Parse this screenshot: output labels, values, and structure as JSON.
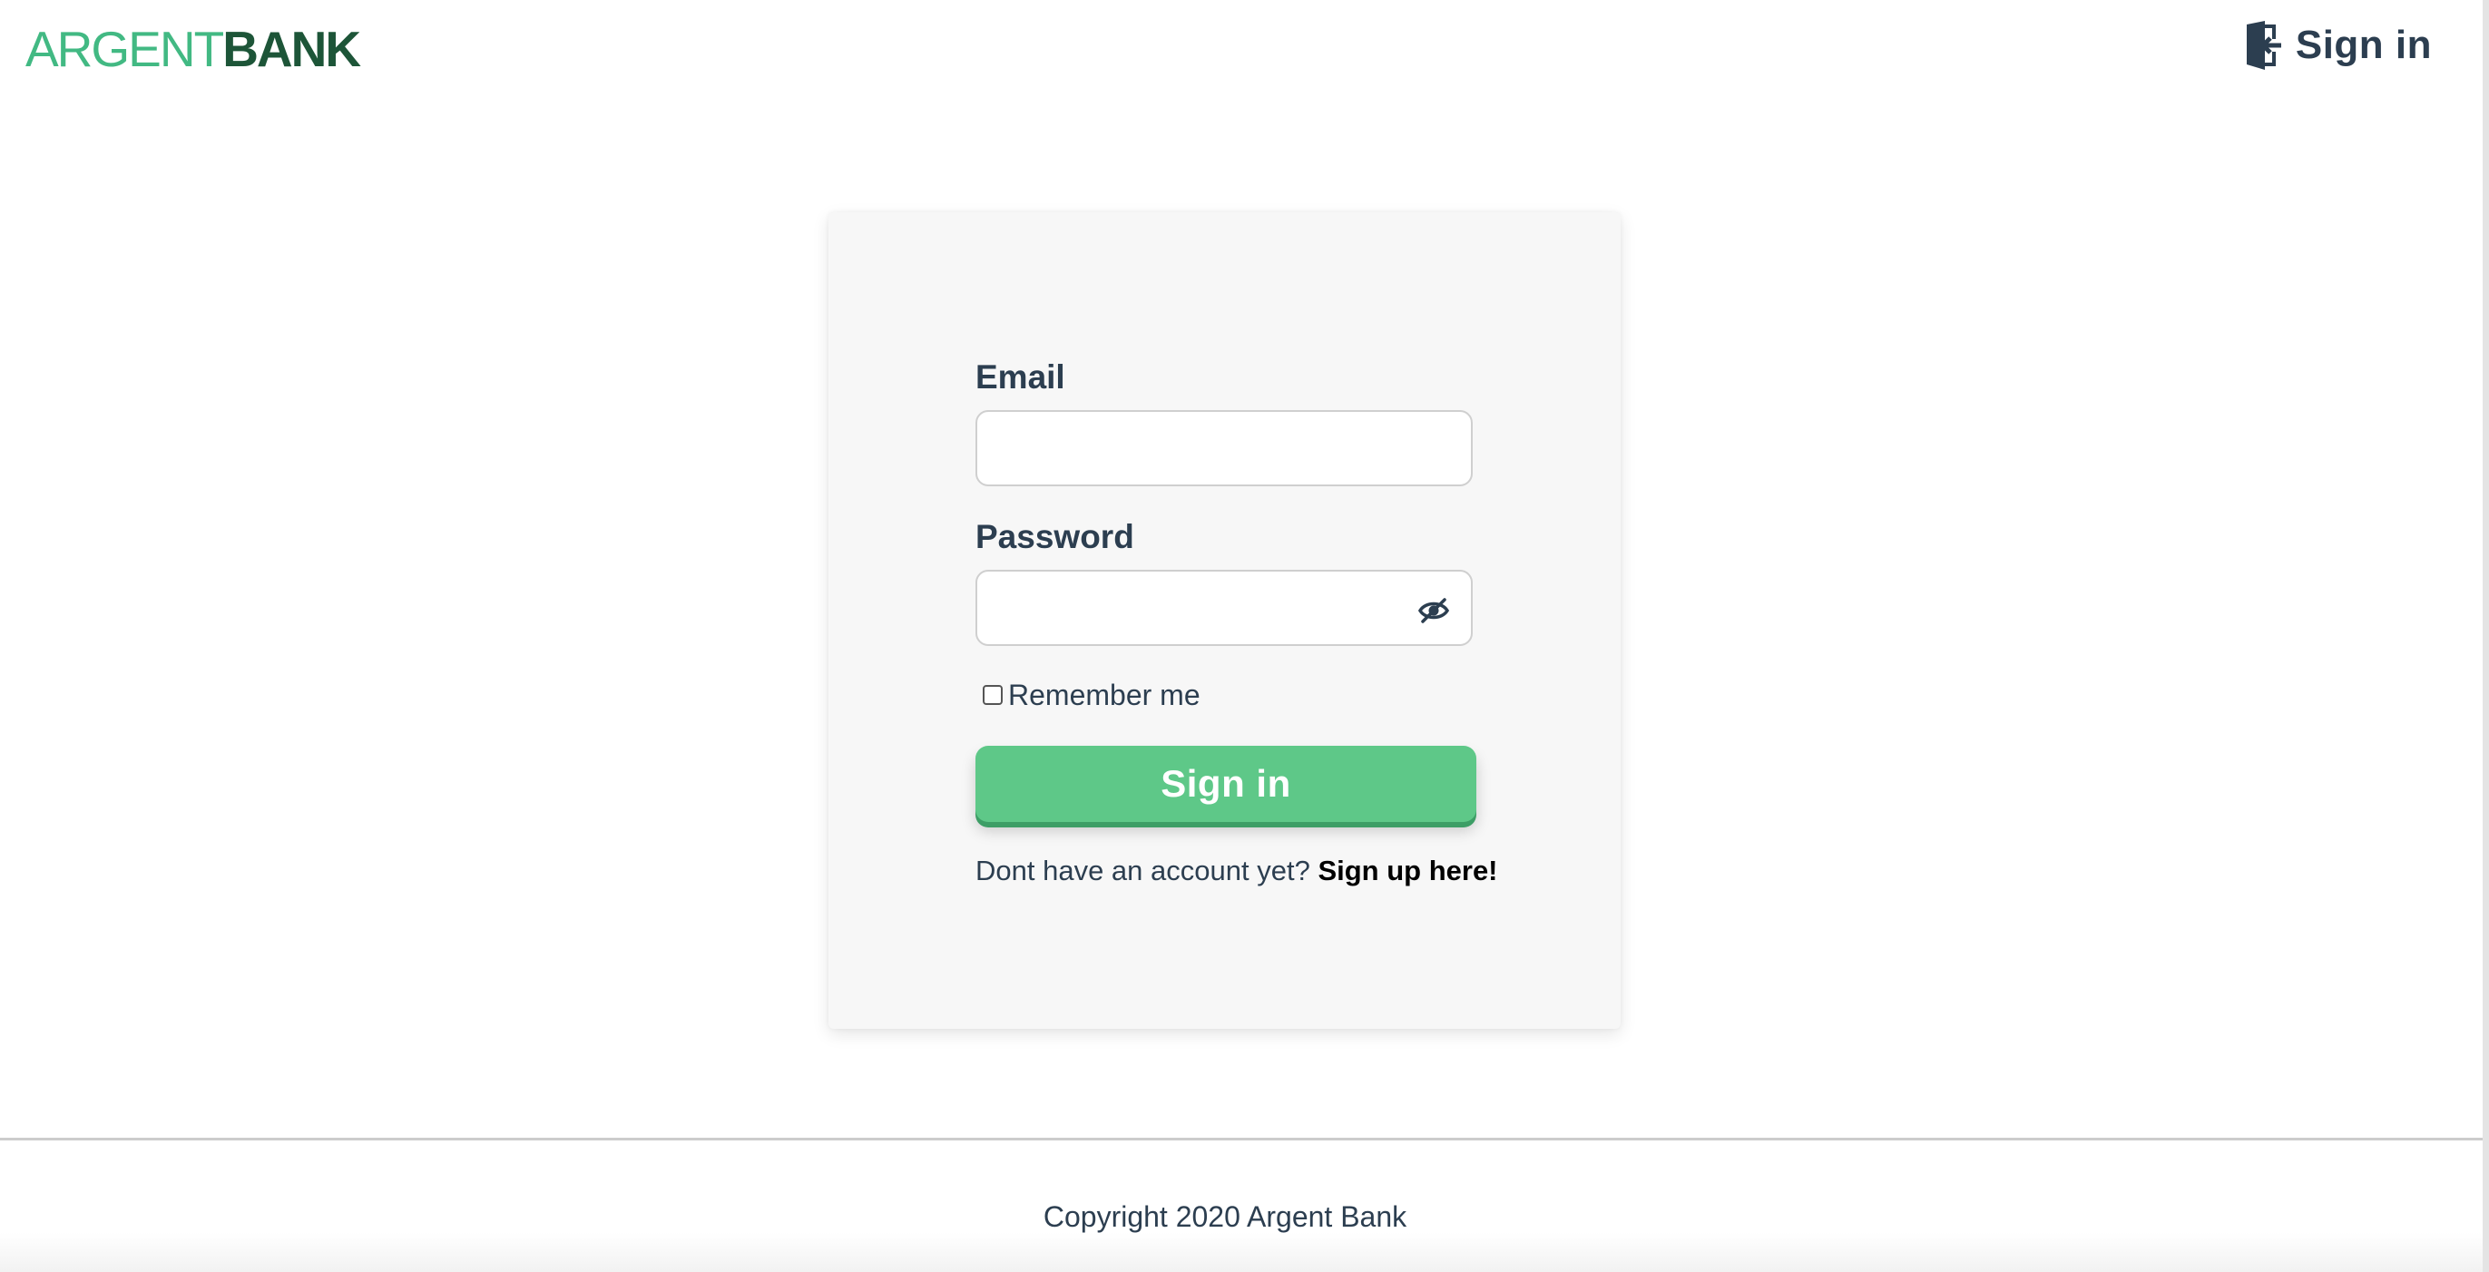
{
  "header": {
    "logo_part_1": "ARGENT",
    "logo_part_2": "BANK",
    "nav_signin_label": "Sign in",
    "nav_signin_icon": "sign-in-door-icon"
  },
  "login_form": {
    "email_label": "Email",
    "email_value": "",
    "password_label": "Password",
    "password_value": "",
    "password_toggle_icon": "eye-slash-icon",
    "remember_label": "Remember me",
    "remember_checked": false,
    "submit_label": "Sign in",
    "signup_prompt": "Dont have an account yet?",
    "signup_link": "Sign up here!"
  },
  "footer": {
    "copyright": "Copyright 2020 Argent Bank"
  },
  "colors": {
    "brand_green": "#42b983",
    "brand_dark_green": "#1d5538",
    "button_green": "#5ec888",
    "text": "#2c3e50"
  }
}
